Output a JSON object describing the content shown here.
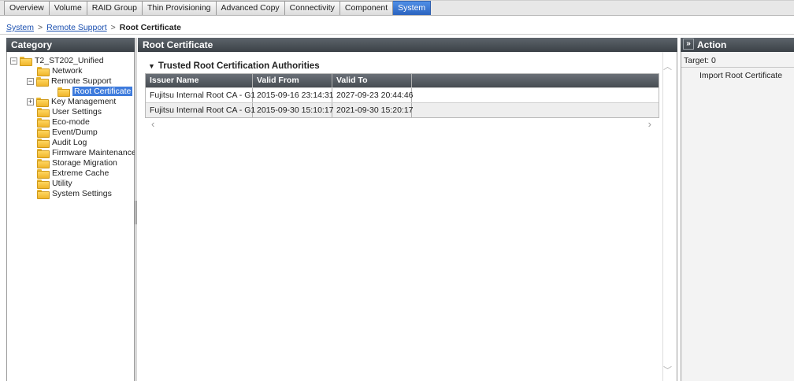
{
  "tabs": [
    {
      "label": "Overview",
      "active": false
    },
    {
      "label": "Volume",
      "active": false
    },
    {
      "label": "RAID Group",
      "active": false
    },
    {
      "label": "Thin Provisioning",
      "active": false
    },
    {
      "label": "Advanced Copy",
      "active": false
    },
    {
      "label": "Connectivity",
      "active": false
    },
    {
      "label": "Component",
      "active": false
    },
    {
      "label": "System",
      "active": true
    }
  ],
  "breadcrumb": {
    "items": [
      "System",
      "Remote Support"
    ],
    "separator": ">",
    "current": "Root Certificate"
  },
  "category": {
    "title": "Category",
    "tree": [
      {
        "label": "T2_ST202_Unified",
        "toggle": "−",
        "open_folder": true
      },
      {
        "label": "Network"
      },
      {
        "label": "Remote Support",
        "toggle": "−",
        "open_folder": true
      },
      {
        "label": "Root Certificate",
        "selected": true
      },
      {
        "label": "Key Management",
        "toggle": "+"
      },
      {
        "label": "User Settings"
      },
      {
        "label": "Eco-mode"
      },
      {
        "label": "Event/Dump"
      },
      {
        "label": "Audit Log"
      },
      {
        "label": "Firmware Maintenance"
      },
      {
        "label": "Storage Migration"
      },
      {
        "label": "Extreme Cache"
      },
      {
        "label": "Utility"
      },
      {
        "label": "System Settings"
      }
    ]
  },
  "main": {
    "title": "Root Certificate",
    "section_title": "Trusted Root Certification Authorities",
    "columns": [
      "Issuer Name",
      "Valid From",
      "Valid To",
      ""
    ],
    "rows": [
      [
        "Fujitsu Internal Root CA - G1",
        "2015-09-16 23:14:31",
        "2027-09-23 20:44:46",
        ""
      ],
      [
        "Fujitsu Internal Root CA - G1",
        "2015-09-30 15:10:17",
        "2021-09-30 15:20:17",
        ""
      ]
    ]
  },
  "action": {
    "collapse_glyph": "»",
    "title": "Action",
    "target_label": "Target: 0",
    "buttons": [
      "Import Root Certificate"
    ]
  },
  "colors": {
    "active_tab": "#3a78d6",
    "panel_header": "#474c52",
    "selected_node": "#3e7bdc",
    "link": "#1a4fb0"
  }
}
